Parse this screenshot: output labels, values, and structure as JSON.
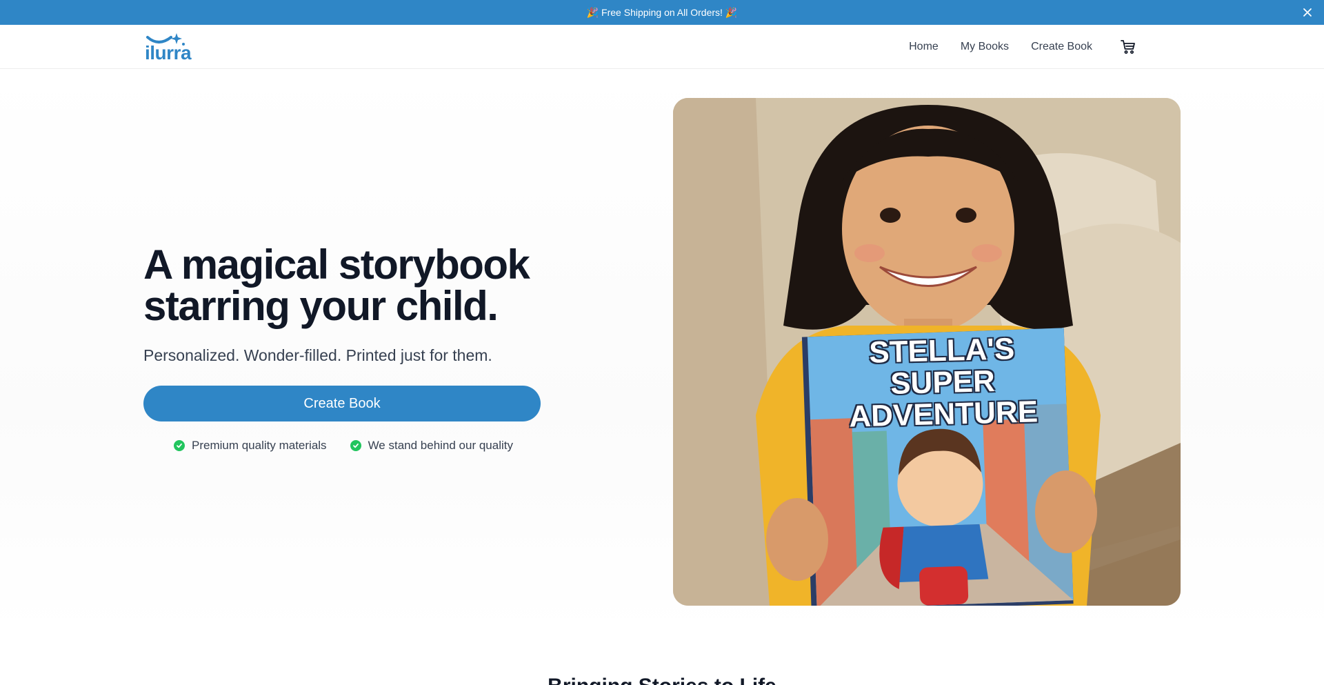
{
  "announcement": {
    "text": "🎉 Free Shipping on All Orders! 🎉",
    "close_icon": "close-icon"
  },
  "header": {
    "logo_text": "ilurra",
    "logo_icon": "smile-sparkle-icon",
    "nav": {
      "home": "Home",
      "my_books": "My Books",
      "create_book": "Create Book"
    },
    "cart_icon": "cart-icon"
  },
  "hero": {
    "title": "A magical storybook starring your child.",
    "subtitle": "Personalized. Wonder-filled. Printed just for them.",
    "cta_label": "Create Book",
    "features": [
      {
        "icon": "check-circle-icon",
        "label": "Premium quality materials"
      },
      {
        "icon": "check-circle-icon",
        "label": "We stand behind our quality"
      }
    ],
    "image": {
      "cover_title": "STELLA'S SUPER ADVENTURE"
    }
  },
  "section": {
    "title": "Bringing Stories to Life"
  },
  "colors": {
    "brand": "#2f86c6",
    "check": "#22c55e",
    "text": "#111827"
  }
}
